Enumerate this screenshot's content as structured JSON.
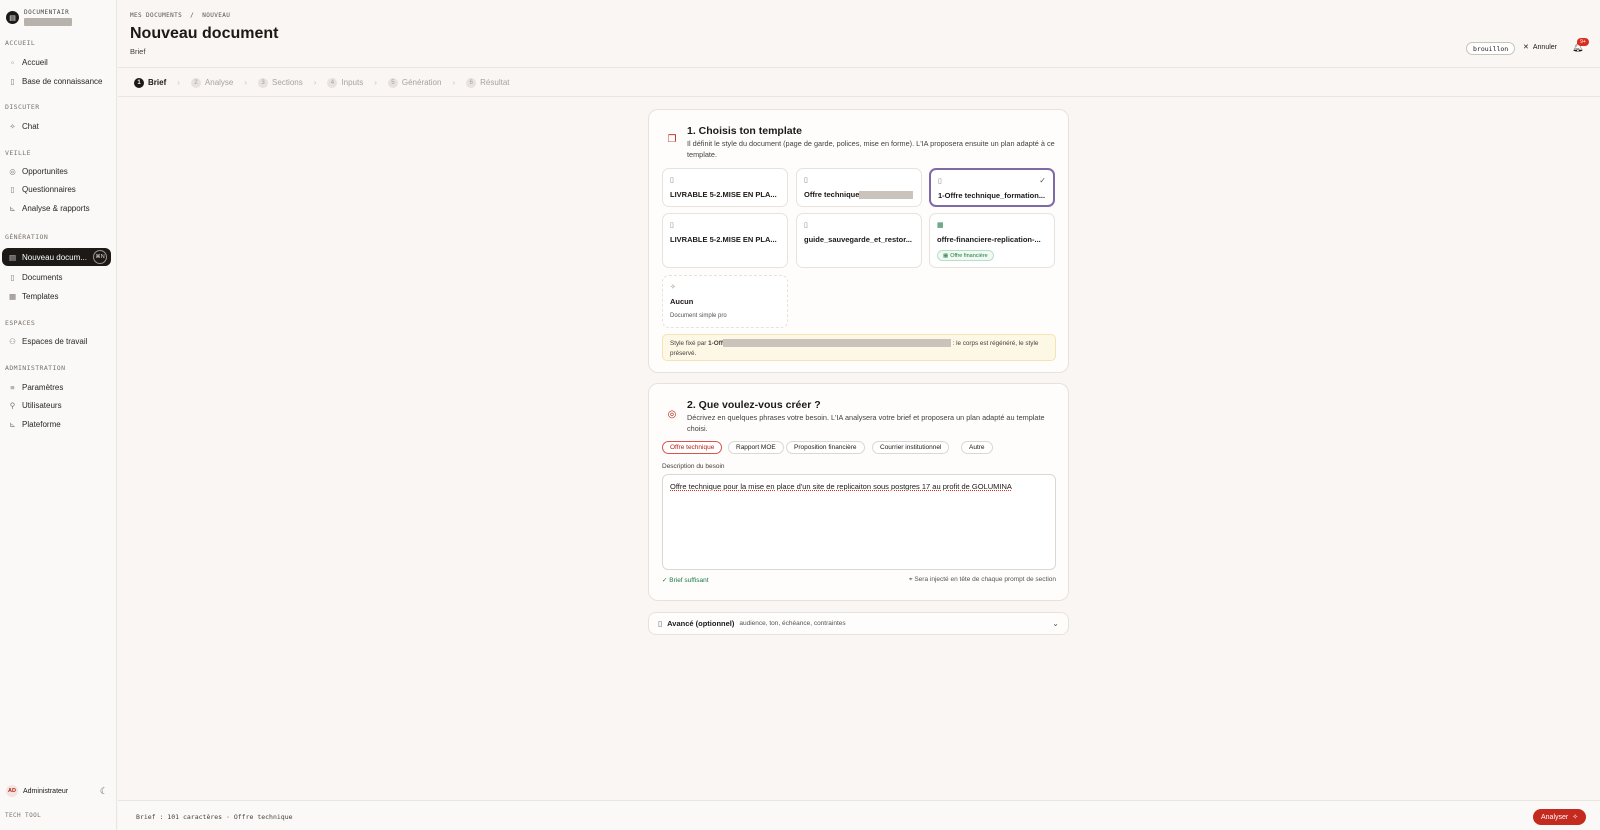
{
  "sidebar": {
    "brand": "DOCUMENTAIR",
    "sections": [
      {
        "title": "ACCUEIL",
        "items": [
          {
            "label": "Accueil"
          },
          {
            "label": "Base de connaissance"
          }
        ]
      },
      {
        "title": "DISCUTER",
        "items": [
          {
            "label": "Chat"
          }
        ]
      },
      {
        "title": "VEILLE",
        "items": [
          {
            "label": "Opportunites"
          },
          {
            "label": "Questionnaires"
          },
          {
            "label": "Analyse & rapports"
          }
        ]
      },
      {
        "title": "GÉNÉRATION",
        "items": [
          {
            "label": "Nouveau docum...",
            "kbd": "⌘N"
          },
          {
            "label": "Documents"
          },
          {
            "label": "Templates"
          }
        ]
      },
      {
        "title": "ESPACES",
        "items": [
          {
            "label": "Espaces de travail"
          }
        ]
      },
      {
        "title": "ADMINISTRATION",
        "items": [
          {
            "label": "Paramètres"
          },
          {
            "label": "Utilisateurs"
          },
          {
            "label": "Plateforme"
          }
        ]
      }
    ],
    "user": {
      "initials": "AD",
      "name": "Administrateur"
    },
    "footer": "TECH TOOL"
  },
  "header": {
    "breadcrumb": "MES DOCUMENTS  /  NOUVEAU",
    "title": "Nouveau document",
    "subtitle": "Brief",
    "status": "brouillon",
    "cancel": "Annuler",
    "notif_badge": "9+"
  },
  "steps": [
    {
      "num": "1",
      "label": "Brief"
    },
    {
      "num": "2",
      "label": "Analyse"
    },
    {
      "num": "3",
      "label": "Sections"
    },
    {
      "num": "4",
      "label": "Inputs"
    },
    {
      "num": "5",
      "label": "Génération"
    },
    {
      "num": "6",
      "label": "Résultat"
    }
  ],
  "template_card": {
    "title": "1. Choisis ton template",
    "description": "Il définit le style du document (page de garde, polices, mise en forme). L'IA proposera ensuite un plan adapté à ce template.",
    "templates": [
      {
        "name": "LIVRABLE 5-2.MISE EN PLA..."
      },
      {
        "name": "Offre technique"
      },
      {
        "name": "1-Offre technique_formation..."
      },
      {
        "name": "LIVRABLE 5-2.MISE EN PLA..."
      },
      {
        "name": "guide_sauvegarde_et_restor..."
      },
      {
        "name": "offre-financiere-replication-...",
        "tag": "Offre financière"
      }
    ],
    "none_option": {
      "name": "Aucun",
      "sub": "Document simple pro"
    },
    "notice_prefix": "Style fixé par ",
    "notice_bold": "1-Off",
    "notice_suffix": " : le corps est régénéré, le style préservé."
  },
  "create_card": {
    "title": "2. Que voulez-vous créer ?",
    "description": "Décrivez en quelques phrases votre besoin. L'IA analysera votre brief et proposera un plan adapté au template choisi.",
    "chips": [
      "Offre technique",
      "Rapport MOE",
      "Proposition financière",
      "Courrier institutionnel",
      "Autre"
    ],
    "field_label": "Description du besoin",
    "value": "Offre technique pour la mise en place d'un site de replicaiton sous postgres 17 au profit de GOLUMINA",
    "ok": "✓ Brief suffisant",
    "hint": "Sera injecté en tête de chaque prompt de section"
  },
  "advanced": {
    "label": "Avancé (optionnel)",
    "sub": "audience, ton, échéance, contraintes"
  },
  "footer": {
    "status": "Brief : 101 caractères · Offre technique",
    "button": "Analyser"
  }
}
